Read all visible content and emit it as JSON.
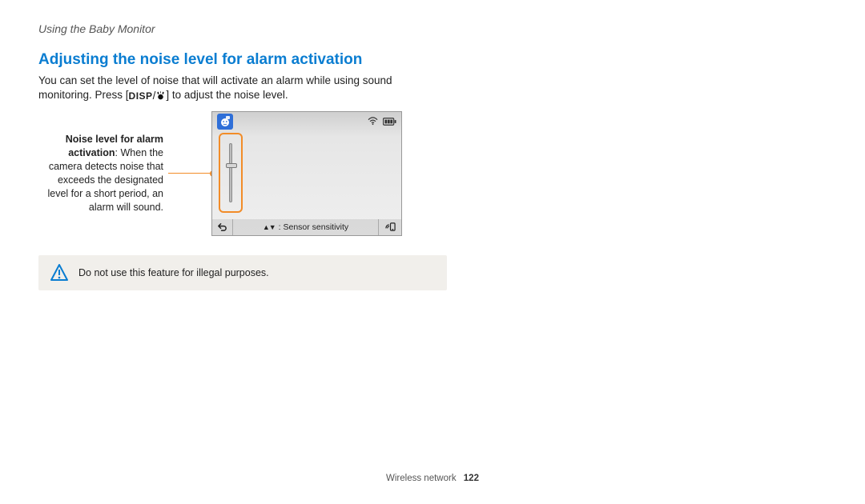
{
  "breadcrumb": "Using the Baby Monitor",
  "section": {
    "title": "Adjusting the noise level for alarm activation",
    "desc_before": "You can set the level of noise that will activate an alarm while using sound monitoring. Press [",
    "disp_label": "DISP",
    "desc_after": "] to adjust the noise level."
  },
  "callout": {
    "heading": "Noise level for alarm activation",
    "body": ": When the camera detects noise that exceeds the designated level for a short period, an alarm will sound."
  },
  "screen": {
    "bottombar_label": ": Sensor sensitivity"
  },
  "warning": {
    "text": "Do not use this feature for illegal purposes."
  },
  "footer": {
    "section": "Wireless network",
    "page": "122"
  }
}
